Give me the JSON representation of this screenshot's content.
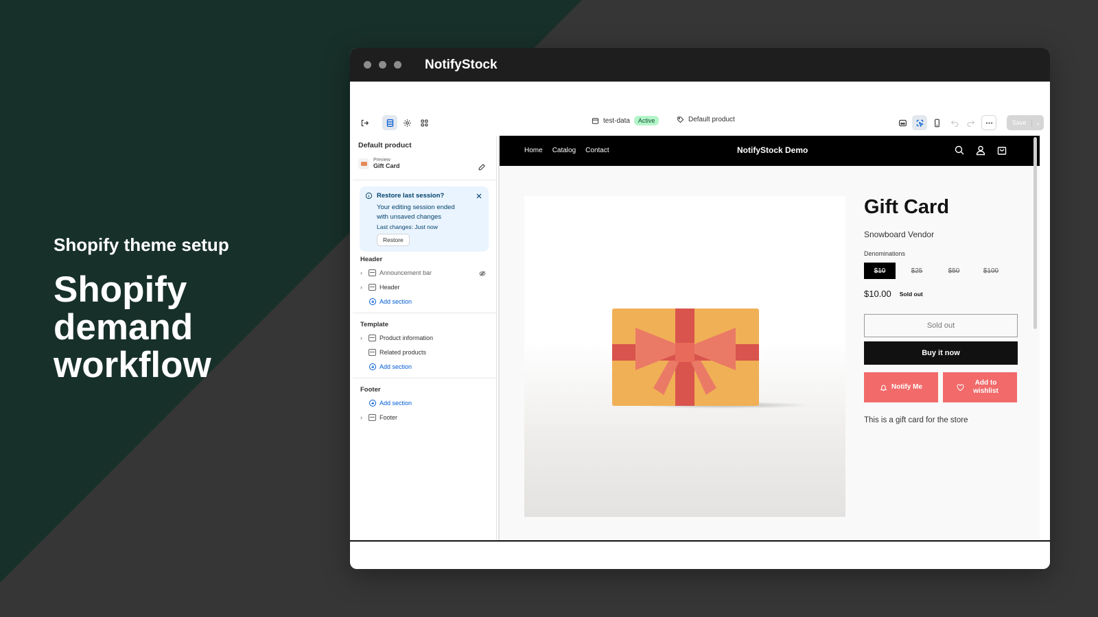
{
  "hero": {
    "kicker": "Shopify theme setup",
    "title_lines": [
      "Shopify",
      "demand",
      "workflow"
    ]
  },
  "window": {
    "title": "NotifyStock"
  },
  "toolbar": {
    "theme_name": "test-data",
    "theme_status": "Active",
    "template": "Default product",
    "save_label": "Save"
  },
  "sidebar": {
    "title": "Default product",
    "preview_label": "Preview",
    "preview_item": "Gift Card",
    "restore": {
      "title": "Restore last session?",
      "body": "Your editing session ended with unsaved changes",
      "last_changes": "Last changes: Just now",
      "button": "Restore"
    },
    "groups": {
      "header": {
        "title": "Header",
        "items": [
          "Announcement bar",
          "Header"
        ],
        "add": "Add section"
      },
      "template": {
        "title": "Template",
        "items": [
          "Product information",
          "Related products"
        ],
        "add": "Add section"
      },
      "footer": {
        "title": "Footer",
        "add": "Add section",
        "items": [
          "Footer"
        ]
      }
    }
  },
  "store": {
    "nav": [
      "Home",
      "Catalog",
      "Contact"
    ],
    "brand": "NotifyStock Demo",
    "product": {
      "title": "Gift Card",
      "vendor": "Snowboard Vendor",
      "denominations_label": "Denominations",
      "denominations": [
        "$10",
        "$25",
        "$50",
        "$100"
      ],
      "selected_denomination": "$10",
      "price": "$10.00",
      "badge": "Sold out",
      "sold_out_button": "Sold out",
      "buy_now_button": "Buy it now",
      "notify_button": "Notify Me",
      "wishlist_button": "Add to wishlist",
      "description": "This is a gift card for the store"
    }
  },
  "colors": {
    "accent_pink": "#f26a6a",
    "active_badge": "#b3f5c9",
    "link_blue": "#005bd3",
    "hero_green": "#18302a"
  },
  "icons": [
    "exit-icon",
    "sections-icon",
    "settings-gear-icon",
    "apps-icon",
    "theme-icon",
    "tag-icon",
    "inspector-icon",
    "select-icon",
    "mobile-icon",
    "undo-icon",
    "redo-icon",
    "more-icon",
    "search-icon",
    "account-icon",
    "cart-icon",
    "bell-icon",
    "heart-icon",
    "edit-pencil-icon",
    "info-icon",
    "close-icon",
    "eye-off-icon",
    "chevron-right-icon"
  ]
}
